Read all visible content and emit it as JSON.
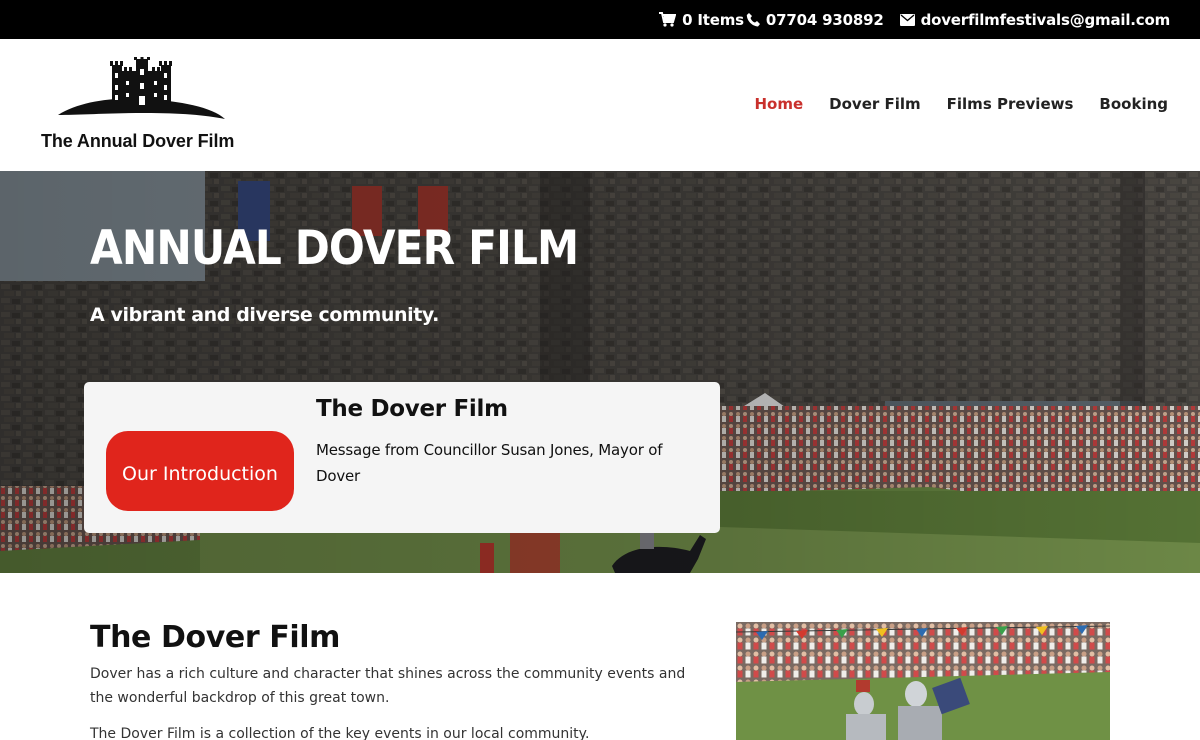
{
  "topbar": {
    "cart_icon": "cart-icon",
    "cart_label": "0 Items",
    "phone_icon": "phone-icon",
    "phone": "07704 930892",
    "email_icon": "envelope-icon",
    "email": "doverfilmfestivals@gmail.com"
  },
  "header": {
    "logo_text": "The Annual Dover Film",
    "logo_icon": "castle-icon",
    "nav": [
      {
        "label": "Home",
        "active": true
      },
      {
        "label": "Dover Film",
        "active": false
      },
      {
        "label": "Films Previews",
        "active": false
      },
      {
        "label": "Booking",
        "active": false
      }
    ]
  },
  "hero": {
    "title": "ANNUAL DOVER FILM",
    "subtitle": "A vibrant and diverse community.",
    "card": {
      "button_label": "Our Introduction",
      "title": "The Dover Film",
      "text": "Message from Councillor Susan Jones, Mayor of Dover"
    }
  },
  "content": {
    "title": "The Dover Film",
    "paragraph1": "Dover has a rich culture and character that shines across the community events and the wonderful backdrop of this great town.",
    "paragraph2": "The Dover Film is a collection of the key events in our local community."
  },
  "colors": {
    "accent": "#c9302c",
    "button": "#e0251c",
    "topbar": "#000000"
  }
}
